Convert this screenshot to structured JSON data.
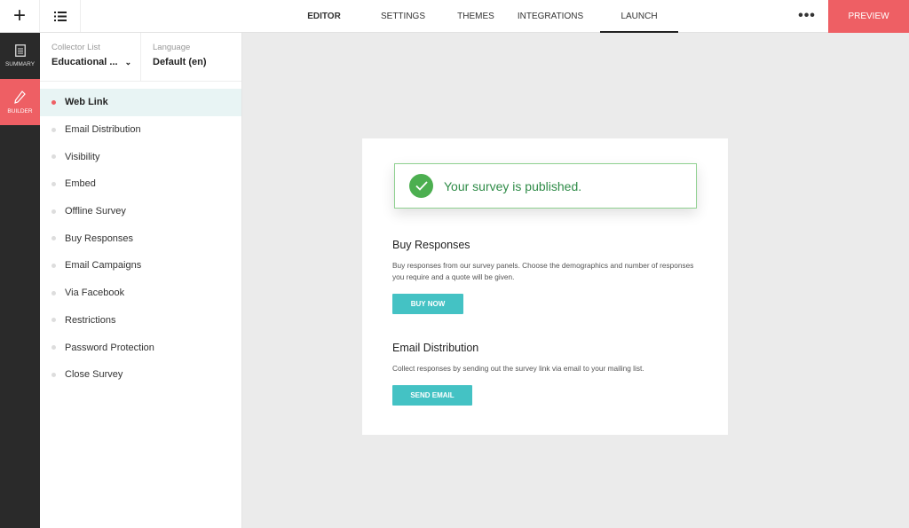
{
  "topbar": {
    "tabs": [
      {
        "label": "EDITOR",
        "bold": true
      },
      {
        "label": "SETTINGS"
      },
      {
        "label": "THEMES"
      },
      {
        "label": "INTEGRATIONS"
      },
      {
        "label": "LAUNCH",
        "active": true
      }
    ],
    "more_label": "•••",
    "preview_label": "PREVIEW"
  },
  "leftnav": {
    "summary_label": "SUMMARY",
    "builder_label": "BUILDER"
  },
  "sidebar": {
    "collector_label": "Collector List",
    "collector_value": "Educational ...",
    "language_label": "Language",
    "language_value": "Default (en)",
    "items": [
      {
        "label": "Web Link",
        "active": true
      },
      {
        "label": "Email Distribution"
      },
      {
        "label": "Visibility"
      },
      {
        "label": "Embed"
      },
      {
        "label": "Offline Survey"
      },
      {
        "label": "Buy Responses"
      },
      {
        "label": "Email Campaigns"
      },
      {
        "label": "Via Facebook"
      },
      {
        "label": "Restrictions"
      },
      {
        "label": "Password Protection"
      },
      {
        "label": "Close Survey"
      }
    ]
  },
  "main": {
    "alert_text": "Your survey is published.",
    "buy": {
      "title": "Buy Responses",
      "description": "Buy responses from our survey panels. Choose the demographics and number of responses you require and a quote will be given.",
      "button": "BUY NOW"
    },
    "email": {
      "title": "Email Distribution",
      "description": "Collect responses by sending out the survey link via email to your mailing list.",
      "button": "SEND EMAIL"
    }
  },
  "colors": {
    "accent": "#ee5f64",
    "teal": "#44c2c4",
    "success": "#4caf50",
    "dark": "#2a2a2a"
  }
}
